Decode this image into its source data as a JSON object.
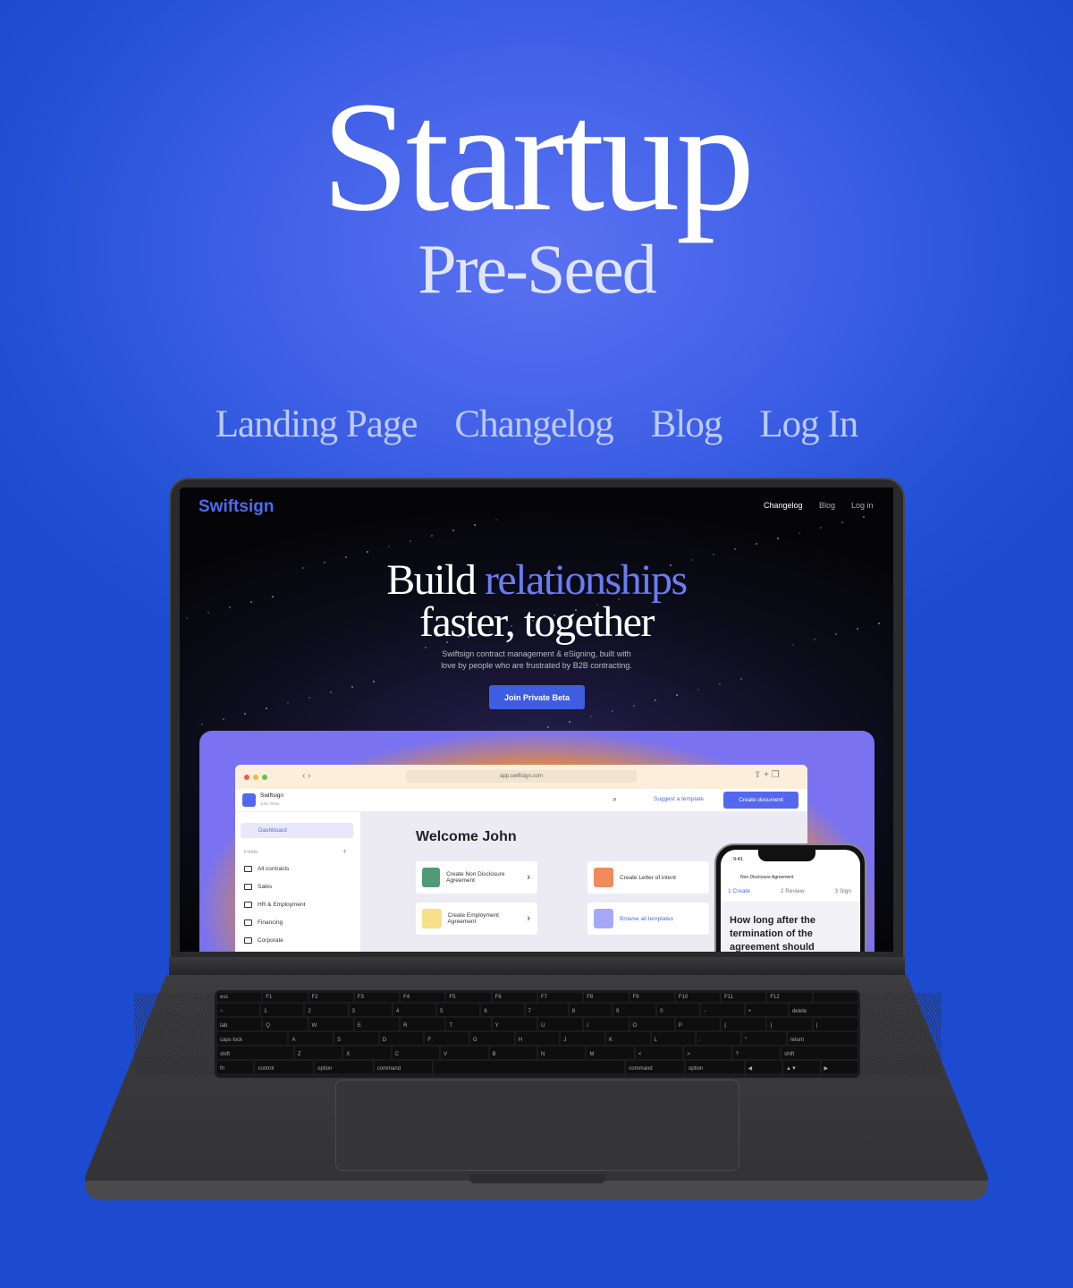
{
  "hero": {
    "title": "Startup",
    "subtitle": "Pre-Seed"
  },
  "nav": [
    {
      "label": "Landing Page"
    },
    {
      "label": "Changelog"
    },
    {
      "label": "Blog"
    },
    {
      "label": "Log In"
    }
  ],
  "colors": {
    "background": "#3f60e6",
    "brand": "#4e6cf0",
    "cta": "#3e5de0",
    "accent_text": "#6c7bf2"
  },
  "site": {
    "brand": "Swiftsign",
    "nav": [
      "Changelog",
      "Blog",
      "Log in"
    ],
    "headline_1": "Build",
    "headline_accent": "relationships",
    "headline_2": "faster, together",
    "description_1": "Swiftsign contract management & eSigning, built with",
    "description_2": "love by people who are frustrated by B2B contracting.",
    "cta": "Join Private Beta"
  },
  "app": {
    "url": "app.swiftsign.com",
    "workspace": "Swiftsign",
    "user": "John Rees",
    "suggest": "Suggest a template",
    "create": "Create document",
    "sidebar": {
      "active": "Dashboard",
      "folder_label": "Folder",
      "folders": [
        "All contracts",
        "Sales",
        "HR & Employment",
        "Financing",
        "Corporate"
      ]
    },
    "welcome": "Welcome John",
    "cards": [
      {
        "label": "Create Non Disclosure Agreement",
        "color": "#4f9a78"
      },
      {
        "label": "Create Letter of intent",
        "color": "#ef8a5a"
      },
      {
        "label": "Create Employment Agreement",
        "color": "#f7e08a"
      },
      {
        "label": "Browse all templates",
        "color": "#a5a9f5"
      }
    ]
  },
  "phone": {
    "time": "9:41",
    "title": "Non Disclosure Agreement",
    "steps": [
      "1 Create",
      "2 Review",
      "3 Sign"
    ],
    "question": "How long after the termination of the agreement should"
  },
  "keyboard": {
    "rows": [
      [
        "esc",
        "F1",
        "F2",
        "F3",
        "F4",
        "F5",
        "F6",
        "F7",
        "F8",
        "F9",
        "F10",
        "F11",
        "F12",
        ""
      ],
      [
        "~",
        "1",
        "2",
        "3",
        "4",
        "5",
        "6",
        "7",
        "8",
        "9",
        "0",
        "-",
        "+",
        "delete"
      ],
      [
        "tab",
        "Q",
        "W",
        "E",
        "R",
        "T",
        "Y",
        "U",
        "I",
        "O",
        "P",
        "{",
        "}",
        "|"
      ],
      [
        "caps lock",
        "A",
        "S",
        "D",
        "F",
        "G",
        "H",
        "J",
        "K",
        "L",
        ":",
        "\"",
        "return"
      ],
      [
        "shift",
        "Z",
        "X",
        "C",
        "V",
        "B",
        "N",
        "M",
        "<",
        ">",
        "?",
        "shift"
      ],
      [
        "fn",
        "control",
        "option",
        "command",
        "",
        "command",
        "option",
        "◀",
        "▲▼",
        "▶"
      ]
    ]
  }
}
